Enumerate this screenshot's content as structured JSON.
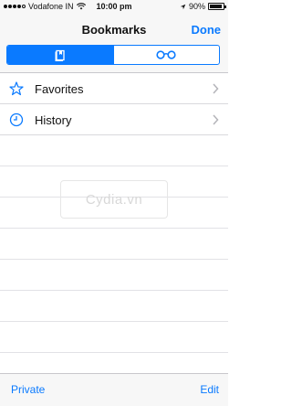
{
  "status_bar": {
    "carrier": "Vodafone IN",
    "time": "10:00 pm",
    "battery": "90%",
    "battery_level": 0.9,
    "signal_bars": 4
  },
  "nav": {
    "title": "Bookmarks",
    "done_label": "Done"
  },
  "segments": [
    {
      "icon": "book-icon",
      "active": true
    },
    {
      "icon": "reading-list-glasses-icon",
      "active": false
    }
  ],
  "list": {
    "items": [
      {
        "label": "Favorites",
        "icon": "star-icon"
      },
      {
        "label": "History",
        "icon": "clock-icon"
      }
    ],
    "empty_rows": 8
  },
  "watermark": "Cydia.vn",
  "toolbar": {
    "left_label": "Private",
    "right_label": "Edit"
  },
  "colors": {
    "accent": "#0a7aff"
  }
}
